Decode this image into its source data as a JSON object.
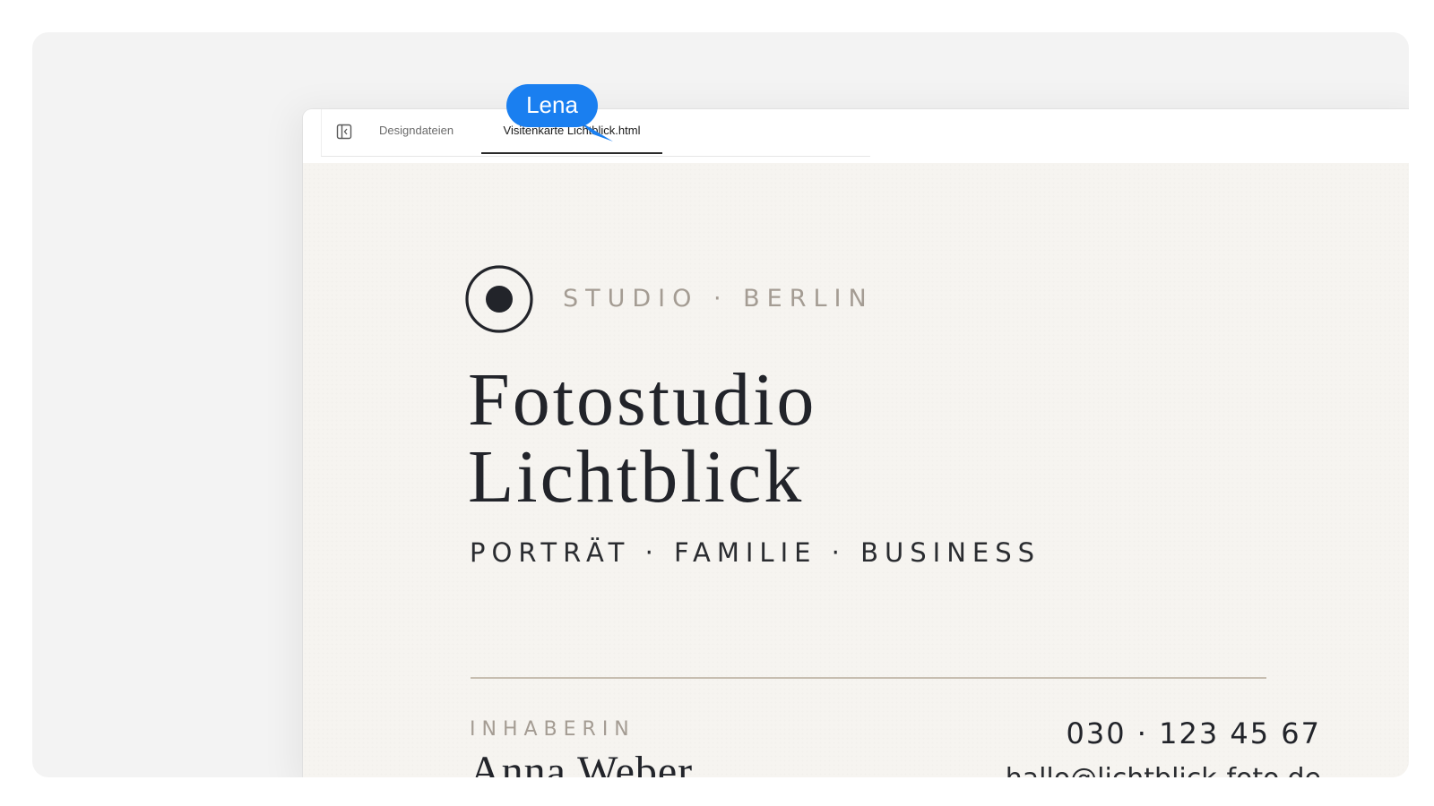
{
  "tabs": {
    "items": [
      {
        "label": "Designdateien"
      },
      {
        "label": "Visitenkarte Lichtblick.html"
      }
    ]
  },
  "card": {
    "kicker": "STUDIO · BERLIN",
    "title_line1": "Fotostudio",
    "title_line2": "Lichtblick",
    "services": "PORTRÄT · FAMILIE · BUSINESS",
    "owner_label": "INHABERIN",
    "owner_name": "Anna Weber",
    "phone": "030 · 123 45 67",
    "email": "hallo@lichtblick-foto.de"
  },
  "collaborator": {
    "name": "Lena",
    "color": "#1a7ff0"
  },
  "icons": {
    "sidebar_toggle": "sidebar-toggle-icon",
    "logo": "aperture-logo-icon"
  }
}
